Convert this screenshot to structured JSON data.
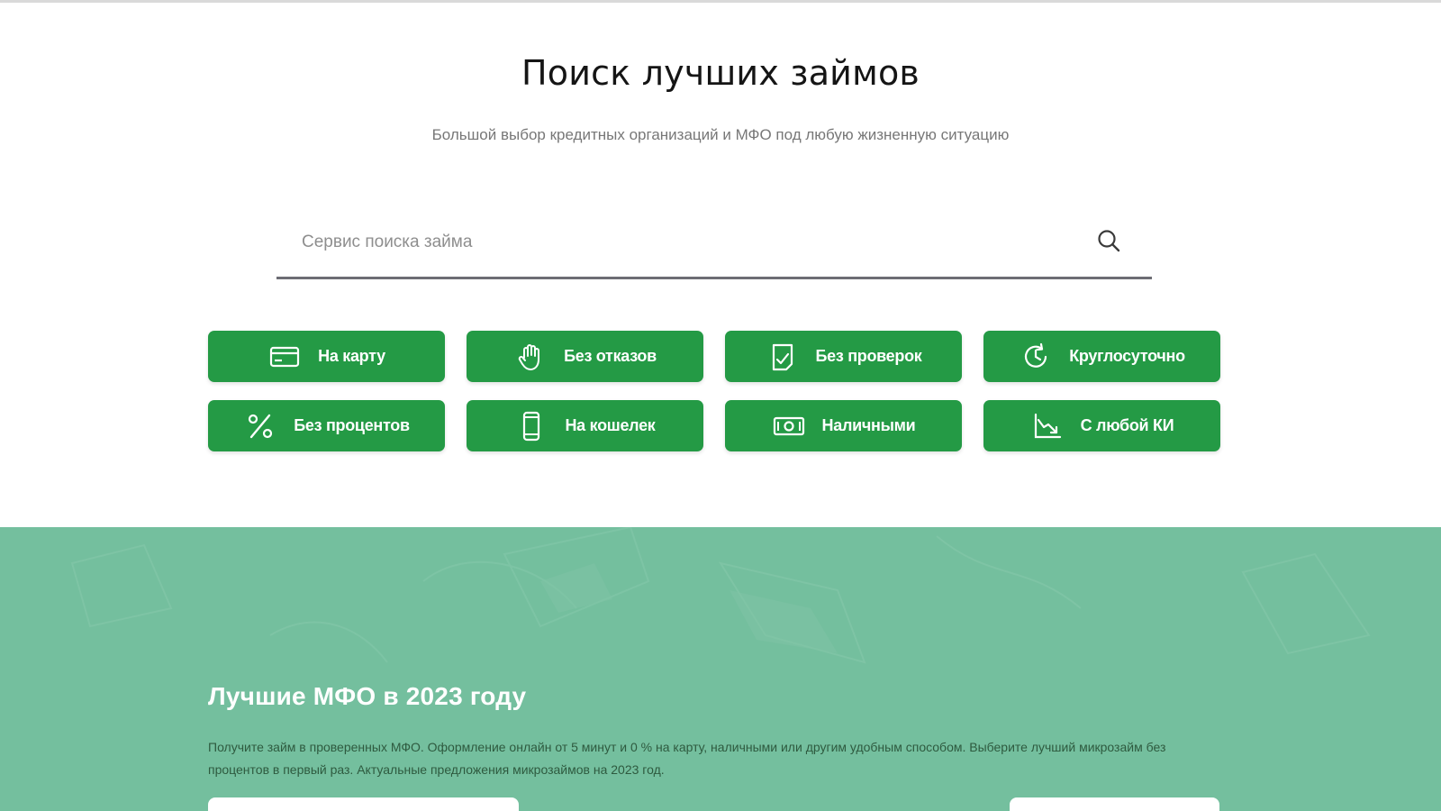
{
  "hero": {
    "title": "Поиск лучших займов",
    "subtitle": "Большой выбор кредитных организаций и МФО под любую жизненную ситуацию"
  },
  "search": {
    "placeholder": "Сервис поиска займа",
    "value": "",
    "icon": "search-icon"
  },
  "categories": [
    {
      "label": "На карту",
      "icon": "card-icon"
    },
    {
      "label": "Без отказов",
      "icon": "hand-icon"
    },
    {
      "label": "Без проверок",
      "icon": "document-check-icon"
    },
    {
      "label": "Круглосуточно",
      "icon": "clock-refresh-icon"
    },
    {
      "label": "Без процентов",
      "icon": "percent-icon"
    },
    {
      "label": "На кошелек",
      "icon": "phone-wallet-icon"
    },
    {
      "label": "Наличными",
      "icon": "cash-icon"
    },
    {
      "label": "С любой КИ",
      "icon": "chart-down-icon"
    }
  ],
  "mfo": {
    "title": "Лучшие МФО в 2023 году",
    "description": "Получите займ в проверенных МФО. Оформление онлайн от 5 минут и 0 % на карту, наличными или другим удобным способом. Выберите лучший микрозайм без процентов в первый раз. Актуальные предложения микрозаймов на 2023 год."
  },
  "colors": {
    "tile_green": "#249a45",
    "section_green": "#74bf9e",
    "search_underline": "#6d6d74"
  }
}
